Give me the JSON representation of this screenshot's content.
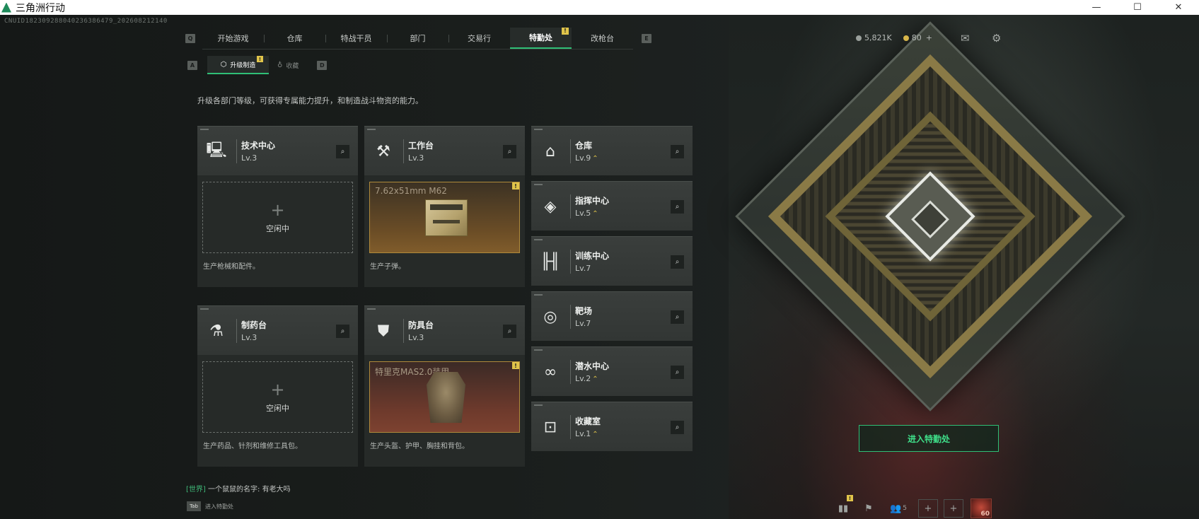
{
  "window": {
    "title": "三角洲行动",
    "controls": {
      "minimize": "—",
      "maximize": "☐",
      "close": "✕"
    }
  },
  "uid": "CNUID18230928804023638647​9_20260821214​0",
  "nav": {
    "left_key": "Q",
    "right_key": "E",
    "tabs": [
      {
        "label": "开始游戏",
        "active": false
      },
      {
        "label": "仓库",
        "active": false
      },
      {
        "label": "特战干员",
        "active": false
      },
      {
        "label": "部门",
        "active": false
      },
      {
        "label": "交易行",
        "active": false
      },
      {
        "label": "特勤处",
        "active": true,
        "badge": "!"
      },
      {
        "label": "改枪台",
        "active": false
      }
    ]
  },
  "currency": {
    "silver": "5,821K",
    "gold": "80",
    "add": "+"
  },
  "top_icons": {
    "mail": "mail-icon",
    "settings": "gear-icon"
  },
  "subnav": {
    "left_key": "A",
    "right_key": "D",
    "tabs": [
      {
        "label": "升级制造",
        "active": true,
        "badge": "!",
        "icon": "upgrade-icon"
      },
      {
        "label": "收藏",
        "active": false,
        "icon": "collection-icon"
      }
    ]
  },
  "description": "升级各部门等级，可获得专属能力提升，和制造战斗物资的能力。",
  "production_facilities": [
    {
      "name": "技术中心",
      "level": "Lv.3",
      "icon": "computer-icon",
      "status": "空闲中",
      "slot_plus": "+",
      "caption": "生产枪械和配件。"
    },
    {
      "name": "工作台",
      "level": "Lv.3",
      "icon": "tools-icon",
      "item": "7.62x51mm M62",
      "item_badge": "!",
      "caption": "生产子弹。"
    },
    {
      "name": "制药台",
      "level": "Lv.3",
      "icon": "microscope-icon",
      "status": "空闲中",
      "slot_plus": "+",
      "caption": "生产药品、针剂和维修工具包。"
    },
    {
      "name": "防具台",
      "level": "Lv.3",
      "icon": "armor-icon",
      "item": "特里克MAS2.0装甲",
      "item_badge": "!",
      "caption": "生产头盔、护甲、胸挂和背包。"
    }
  ],
  "other_facilities": [
    {
      "name": "仓库",
      "level": "Lv.9",
      "upgradable": true,
      "icon": "warehouse-icon"
    },
    {
      "name": "指挥中心",
      "level": "Lv.5",
      "upgradable": true,
      "icon": "command-icon"
    },
    {
      "name": "训练中心",
      "level": "Lv.7",
      "upgradable": false,
      "icon": "dumbbell-icon"
    },
    {
      "name": "靶场",
      "level": "Lv.7",
      "upgradable": false,
      "icon": "target-icon"
    },
    {
      "name": "潜水中心",
      "level": "Lv.2",
      "upgradable": true,
      "icon": "diving-mask-icon"
    },
    {
      "name": "收藏室",
      "level": "Lv.1",
      "upgradable": true,
      "icon": "vault-icon"
    }
  ],
  "upgrade_arrow": "⌃",
  "magnifier_glyph": "🔍",
  "enter_button": "进入特勤处",
  "chat": {
    "channel": "[世界]",
    "sender": "一个鼠鼠的名字:",
    "message": "有老大吗"
  },
  "tab_hint": {
    "key": "Tab",
    "label": "进入特勤处"
  },
  "bottom_bar": {
    "friends_count": "5",
    "level_badge": "60",
    "stats_badge": "!"
  }
}
